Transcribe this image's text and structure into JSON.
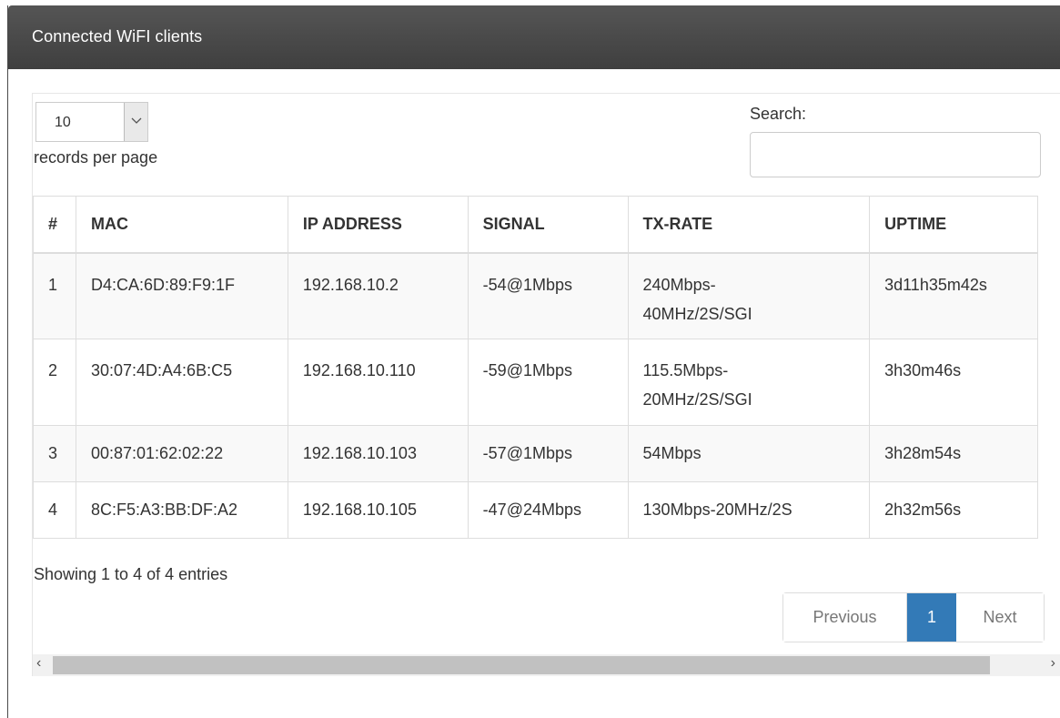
{
  "panel": {
    "title": "Connected WiFI clients"
  },
  "controls": {
    "length_value": "10",
    "length_label": "records per page",
    "search_label": "Search:",
    "search_value": ""
  },
  "table": {
    "headers": [
      "#",
      "MAC",
      "IP ADDRESS",
      "SIGNAL",
      "TX-RATE",
      "UPTIME"
    ],
    "rows": [
      [
        "1",
        "D4:CA:6D:89:F9:1F",
        "192.168.10.2",
        "-54@1Mbps",
        "240Mbps-\n40MHz/2S/SGI",
        "3d11h35m42s"
      ],
      [
        "2",
        "30:07:4D:A4:6B:C5",
        "192.168.10.110",
        "-59@1Mbps",
        "115.5Mbps-\n20MHz/2S/SGI",
        "3h30m46s"
      ],
      [
        "3",
        "00:87:01:62:02:22",
        "192.168.10.103",
        "-57@1Mbps",
        "54Mbps",
        "3h28m54s"
      ],
      [
        "4",
        "8C:F5:A3:BB:DF:A2",
        "192.168.10.105",
        "-47@24Mbps",
        "130Mbps-20MHz/2S",
        "2h32m56s"
      ]
    ]
  },
  "footer": {
    "info": "Showing 1 to 4 of 4 entries",
    "previous": "Previous",
    "current_page": "1",
    "next": "Next"
  },
  "scrollbar": {
    "left_arrow": "‹",
    "right_arrow": "›"
  },
  "colors": {
    "header_bg": "#4a4a4a",
    "active_page": "#337ab7",
    "row_stripe": "#f9f9f9"
  }
}
